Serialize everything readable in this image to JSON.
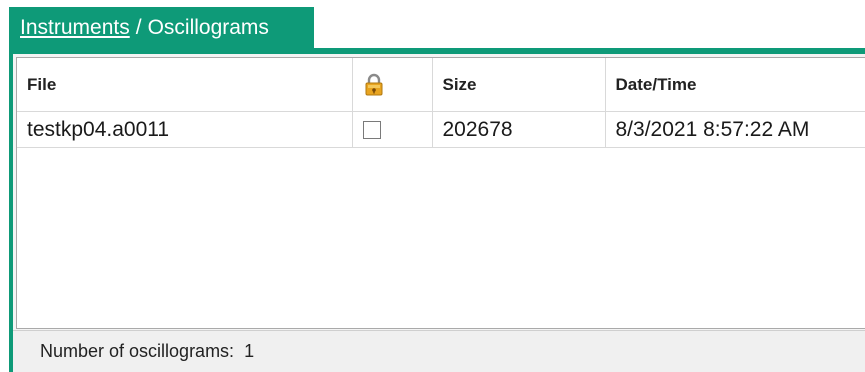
{
  "breadcrumb": {
    "parent": "Instruments",
    "separator": "/",
    "current": "Oscillograms"
  },
  "table": {
    "columns": {
      "file": "File",
      "lock_icon": "lock-icon",
      "size": "Size",
      "datetime": "Date/Time"
    },
    "rows": [
      {
        "file": "testkp04.a0011",
        "locked": false,
        "size": "202678",
        "datetime": "8/3/2021 8:57:22 AM"
      }
    ]
  },
  "status": {
    "label": "Number of oscillograms:",
    "count": "1"
  },
  "colors": {
    "accent": "#0e9a78"
  }
}
